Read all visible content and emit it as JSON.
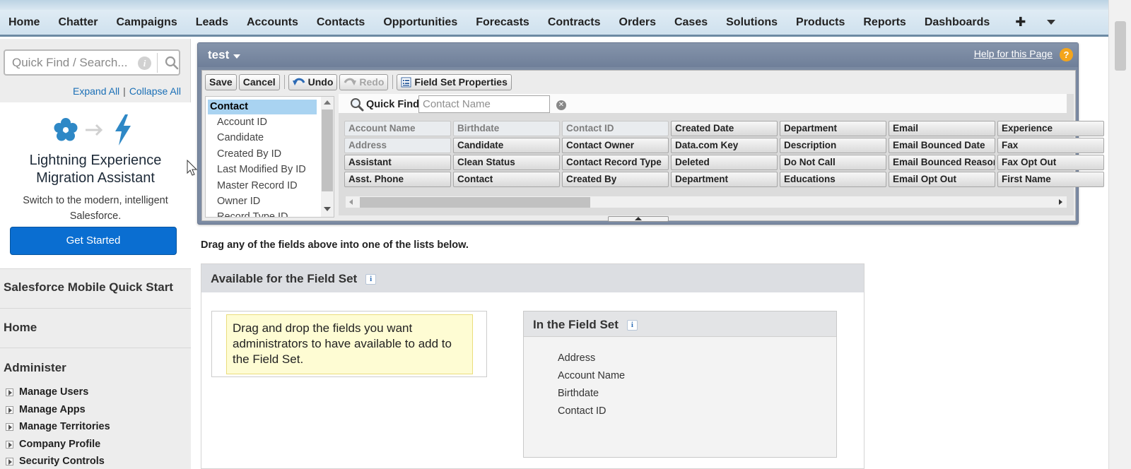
{
  "nav": {
    "tabs": [
      "Home",
      "Chatter",
      "Campaigns",
      "Leads",
      "Accounts",
      "Contacts",
      "Opportunities",
      "Forecasts",
      "Contracts",
      "Orders",
      "Cases",
      "Solutions",
      "Products",
      "Reports",
      "Dashboards"
    ],
    "plus": "✚"
  },
  "sidebar": {
    "search_placeholder": "Quick Find / Search...",
    "info": "i",
    "expand_all": "Expand All",
    "separator": "|",
    "collapse_all": "Collapse All",
    "promo": {
      "title_line1": "Lightning Experience",
      "title_line2": "Migration Assistant",
      "subtitle": "Switch to the modern, intelligent Salesforce.",
      "button": "Get Started"
    },
    "sections": {
      "mobile": "Salesforce Mobile Quick Start",
      "home": "Home",
      "administer": "Administer"
    },
    "admin_items": [
      "Manage Users",
      "Manage Apps",
      "Manage Territories",
      "Company Profile",
      "Security Controls"
    ]
  },
  "editor": {
    "title": "test",
    "help": "Help for this Page",
    "help_icon": "?",
    "toolbar": {
      "save": "Save",
      "cancel": "Cancel",
      "undo": "Undo",
      "redo": "Redo",
      "properties": "Field Set Properties"
    },
    "field_list": [
      "Contact",
      "Account ID",
      "Candidate",
      "Created By ID",
      "Last Modified By ID",
      "Master Record ID",
      "Owner ID",
      "Record Type ID"
    ],
    "quick_find_label": "Quick Find",
    "quick_find_placeholder": "Contact Name",
    "clear": "✕",
    "chips": [
      [
        "Account Name",
        "Birthdate",
        "Contact ID",
        "Created Date",
        "Department",
        "Email",
        "Experience"
      ],
      [
        "Address",
        "Candidate",
        "Contact Owner",
        "Data.com Key",
        "Description",
        "Email Bounced Date",
        "Fax"
      ],
      [
        "Assistant",
        "Clean Status",
        "Contact Record Type",
        "Deleted",
        "Do Not Call",
        "Email Bounced Reason",
        "Fax Opt Out"
      ],
      [
        "Asst. Phone",
        "Contact",
        "Created By",
        "Department",
        "Educations",
        "Email Opt Out",
        "First Name"
      ]
    ],
    "used_chips": [
      "Account Name",
      "Birthdate",
      "Contact ID",
      "Address"
    ]
  },
  "main": {
    "drag_hint": "Drag any of the fields above into one of the lists below.",
    "available_title": "Available for the Field Set",
    "available_note": "Drag and drop the fields you want administrators to have available to add to the Field Set.",
    "in_set_title": "In the Field Set",
    "info": "i",
    "in_set_items": [
      "Address",
      "Account Name",
      "Birthdate",
      "Contact ID"
    ]
  }
}
